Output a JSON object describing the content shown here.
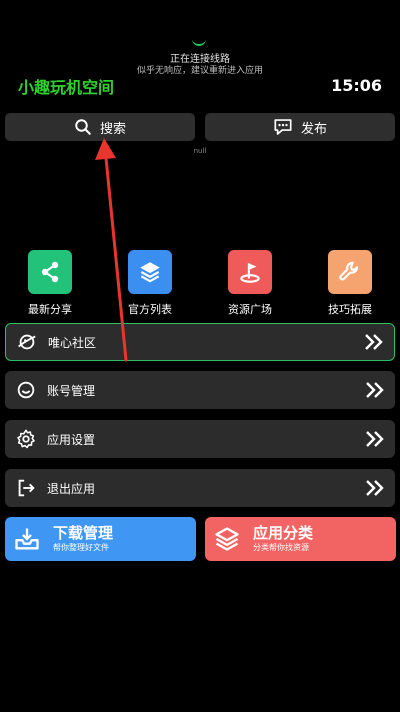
{
  "status": {
    "connecting": "正在连接线路",
    "hint": "似乎无响应，建议重新进入应用"
  },
  "header": {
    "app_title": "小趣玩机空间",
    "time": "15:06"
  },
  "top_buttons": {
    "search": "搜索",
    "publish": "发布"
  },
  "null_text": "null",
  "tiles": [
    {
      "label": "最新分享",
      "color": "#22c27a",
      "icon": "share-icon"
    },
    {
      "label": "官方列表",
      "color": "#3b8ff0",
      "icon": "layers-icon"
    },
    {
      "label": "资源广场",
      "color": "#ef5b5b",
      "icon": "golf-flag-icon"
    },
    {
      "label": "技巧拓展",
      "color": "#f6a46f",
      "icon": "wrench-icon"
    }
  ],
  "menu": [
    {
      "label": "唯心社区",
      "icon": "planet-icon"
    },
    {
      "label": "账号管理",
      "icon": "smile-icon"
    },
    {
      "label": "应用设置",
      "icon": "gear-icon"
    },
    {
      "label": "退出应用",
      "icon": "logout-icon"
    }
  ],
  "cards": {
    "download": {
      "title": "下载管理",
      "subtitle": "帮你整理好文件",
      "color": "#3f96f3"
    },
    "category": {
      "title": "应用分类",
      "subtitle": "分类帮你找资源",
      "color": "#f26464"
    }
  },
  "colors": {
    "accent_green": "#2fd12f",
    "row_bg": "#2c2c2c",
    "active_border": "#2fbf6a",
    "arrow": "#e8362f"
  }
}
